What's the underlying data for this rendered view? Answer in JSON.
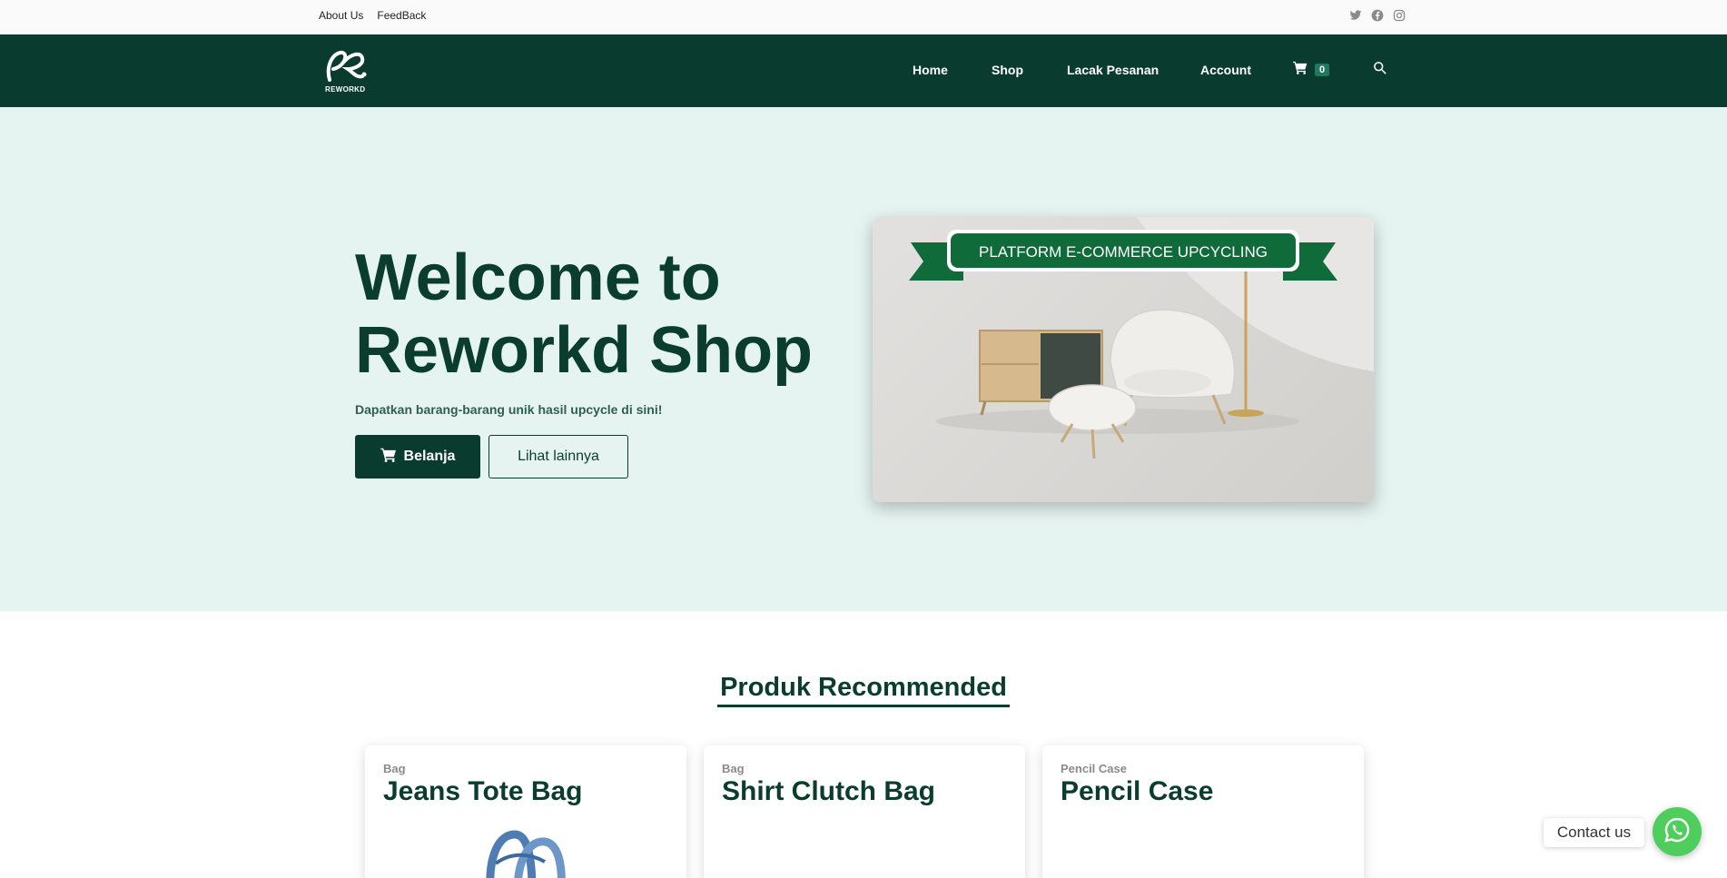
{
  "topbar": {
    "links": [
      "About Us",
      "FeedBack"
    ],
    "social_icons": [
      "twitter-icon",
      "facebook-icon",
      "instagram-icon"
    ]
  },
  "header": {
    "logo_text": "REWORKD",
    "nav": [
      "Home",
      "Shop",
      "Lacak Pesanan",
      "Account"
    ],
    "cart_count": "0",
    "search_icon": "search-icon"
  },
  "hero": {
    "title": "Welcome to Reworkd Shop",
    "subtitle": "Dapatkan barang-barang unik hasil upcycle di sini!",
    "primary_button": "Belanja",
    "secondary_button": "Lihat lainnya",
    "banner_text": "PLATFORM E-COMMERCE UPCYCLING"
  },
  "section": {
    "title": "Produk Recommended"
  },
  "products": [
    {
      "category": "Bag",
      "name": "Jeans Tote Bag"
    },
    {
      "category": "Bag",
      "name": "Shirt Clutch Bag"
    },
    {
      "category": "Pencil Case",
      "name": "Pencil Case"
    }
  ],
  "contact": {
    "label": "Contact us"
  },
  "colors": {
    "primary": "#093c2e",
    "hero_bg": "#e5f3f1",
    "banner_green": "#0f6b3a",
    "whatsapp": "#4fce5d"
  }
}
